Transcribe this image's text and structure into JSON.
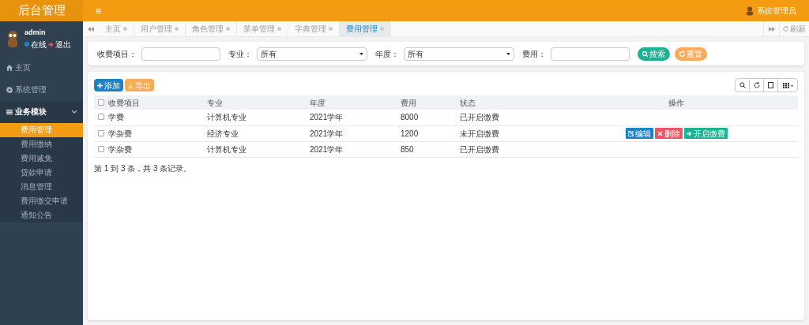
{
  "brand": "后台管理",
  "menu_toggle": "≡",
  "top_user": "系统管理员",
  "profile": {
    "name": "admin",
    "status": "在线",
    "logout": "退出"
  },
  "sidebar": {
    "items": [
      {
        "label": "主页",
        "kind": "home",
        "expanded": false
      },
      {
        "label": "系统管理",
        "kind": "gear",
        "expanded": false
      },
      {
        "label": "业务模块",
        "kind": "list",
        "expanded": true,
        "children": [
          {
            "label": "费用管理",
            "selected": true
          },
          {
            "label": "费用缴纳",
            "selected": false
          },
          {
            "label": "费用减免",
            "selected": false
          },
          {
            "label": "贷款申请",
            "selected": false
          },
          {
            "label": "消息管理",
            "selected": false
          },
          {
            "label": "费用缴交申请",
            "selected": false
          },
          {
            "label": "通知公告",
            "selected": false
          }
        ]
      }
    ]
  },
  "tabs": [
    {
      "label": "主页",
      "selected": false
    },
    {
      "label": "用户管理",
      "selected": false
    },
    {
      "label": "角色管理",
      "selected": false
    },
    {
      "label": "菜单管理",
      "selected": false
    },
    {
      "label": "字典管理",
      "selected": false
    },
    {
      "label": "费用管理",
      "selected": true
    }
  ],
  "refresh_label": "刷新",
  "filters": [
    {
      "kind": "text",
      "label": "收费项目："
    },
    {
      "kind": "select",
      "label": "专业：",
      "value": "所有"
    },
    {
      "kind": "select",
      "label": "年度：",
      "value": "所有"
    },
    {
      "kind": "text",
      "label": "费用："
    }
  ],
  "search_button": "搜索",
  "reset_button": "重置",
  "toolbar": {
    "add": "添加",
    "export": "导出"
  },
  "table": {
    "header_checked": false,
    "columns": [
      "收费项目",
      "专业",
      "年度",
      "费用",
      "状态",
      "操作"
    ],
    "rows": [
      {
        "cells": [
          "学费",
          "计算机专业",
          "2021学年",
          "8000",
          "已开启缴费"
        ],
        "checked": false,
        "actions": []
      },
      {
        "cells": [
          "学杂费",
          "经济专业",
          "2021学年",
          "1200",
          "未开启缴费"
        ],
        "checked": false,
        "actions": [
          {
            "kind": "edit",
            "label": "编辑"
          },
          {
            "kind": "delete",
            "label": "删除"
          },
          {
            "kind": "open",
            "label": "开启缴费"
          }
        ]
      },
      {
        "cells": [
          "学杂费",
          "计算机专业",
          "2021学年",
          "850",
          "已开启缴费"
        ],
        "checked": false,
        "actions": []
      }
    ]
  },
  "pagination": "第 1 到 3 条，共 3 条记录。"
}
